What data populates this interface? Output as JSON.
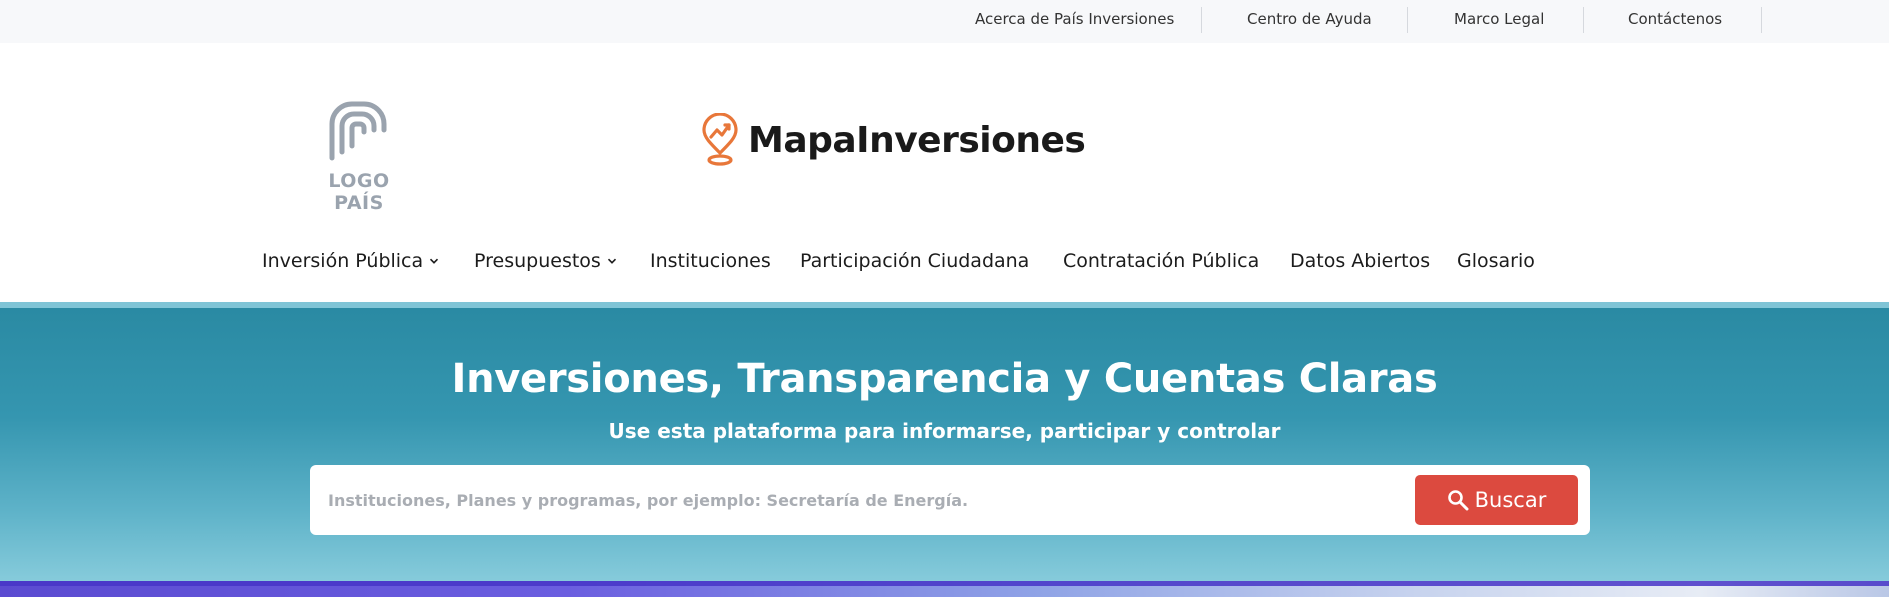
{
  "top_links": [
    {
      "label": "Acerca de País Inversiones"
    },
    {
      "label": "Centro de Ayuda"
    },
    {
      "label": "Marco Legal"
    },
    {
      "label": "Contáctenos"
    }
  ],
  "country_logo": {
    "text": "LOGO PAÍS",
    "color": "#9aa3ae"
  },
  "brand": {
    "name": "MapaInversiones",
    "pin_color": "#e8773a"
  },
  "nav": [
    {
      "label": "Inversión Pública",
      "has_dropdown": true
    },
    {
      "label": "Presupuestos",
      "has_dropdown": true
    },
    {
      "label": "Instituciones",
      "has_dropdown": false
    },
    {
      "label": "Participación Ciudadana",
      "has_dropdown": false
    },
    {
      "label": "Contratación Pública",
      "has_dropdown": false
    },
    {
      "label": "Datos Abiertos",
      "has_dropdown": false
    },
    {
      "label": "Glosario",
      "has_dropdown": false
    }
  ],
  "hero": {
    "title": "Inversiones, Transparencia y Cuentas Claras",
    "subtitle": "Use esta plataforma para informarse, participar y controlar"
  },
  "search": {
    "placeholder": "Instituciones, Planes y programas, por ejemplo: Secretaría de Energía.",
    "value": "",
    "button_label": "Buscar",
    "icon": "search-icon"
  },
  "colors": {
    "accent": "#dc4a3f",
    "hero_top": "#2a8aa3",
    "hero_bottom": "#86cbdb",
    "brand_orange": "#e8773a"
  }
}
